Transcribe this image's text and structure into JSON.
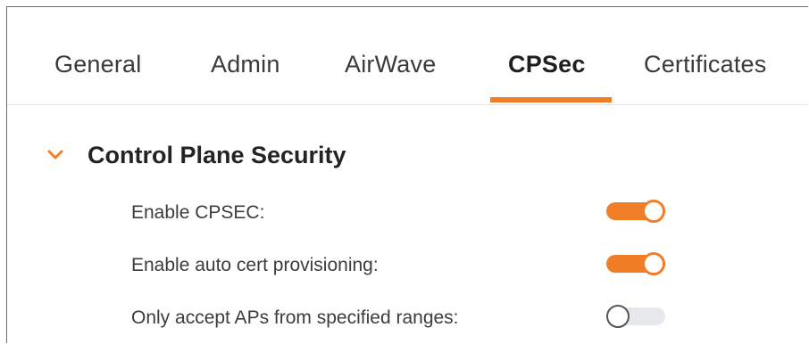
{
  "tabs": [
    {
      "label": "General",
      "active": false
    },
    {
      "label": "Admin",
      "active": false
    },
    {
      "label": "AirWave",
      "active": false
    },
    {
      "label": "CPSec",
      "active": true
    },
    {
      "label": "Certificates",
      "active": false
    }
  ],
  "section": {
    "title": "Control Plane Security",
    "expanded": true,
    "rows": [
      {
        "label": "Enable CPSEC:",
        "enabled": true
      },
      {
        "label": "Enable auto cert provisioning:",
        "enabled": true
      },
      {
        "label": "Only accept APs from specified ranges:",
        "enabled": false
      }
    ]
  },
  "colors": {
    "accent": "#f07e26",
    "toggle_off_track": "#e6e8ec",
    "divider": "#e4e6ea",
    "frame_border": "#6b6b6b"
  },
  "icons": {
    "section_chevron": "chevron-down-icon"
  }
}
